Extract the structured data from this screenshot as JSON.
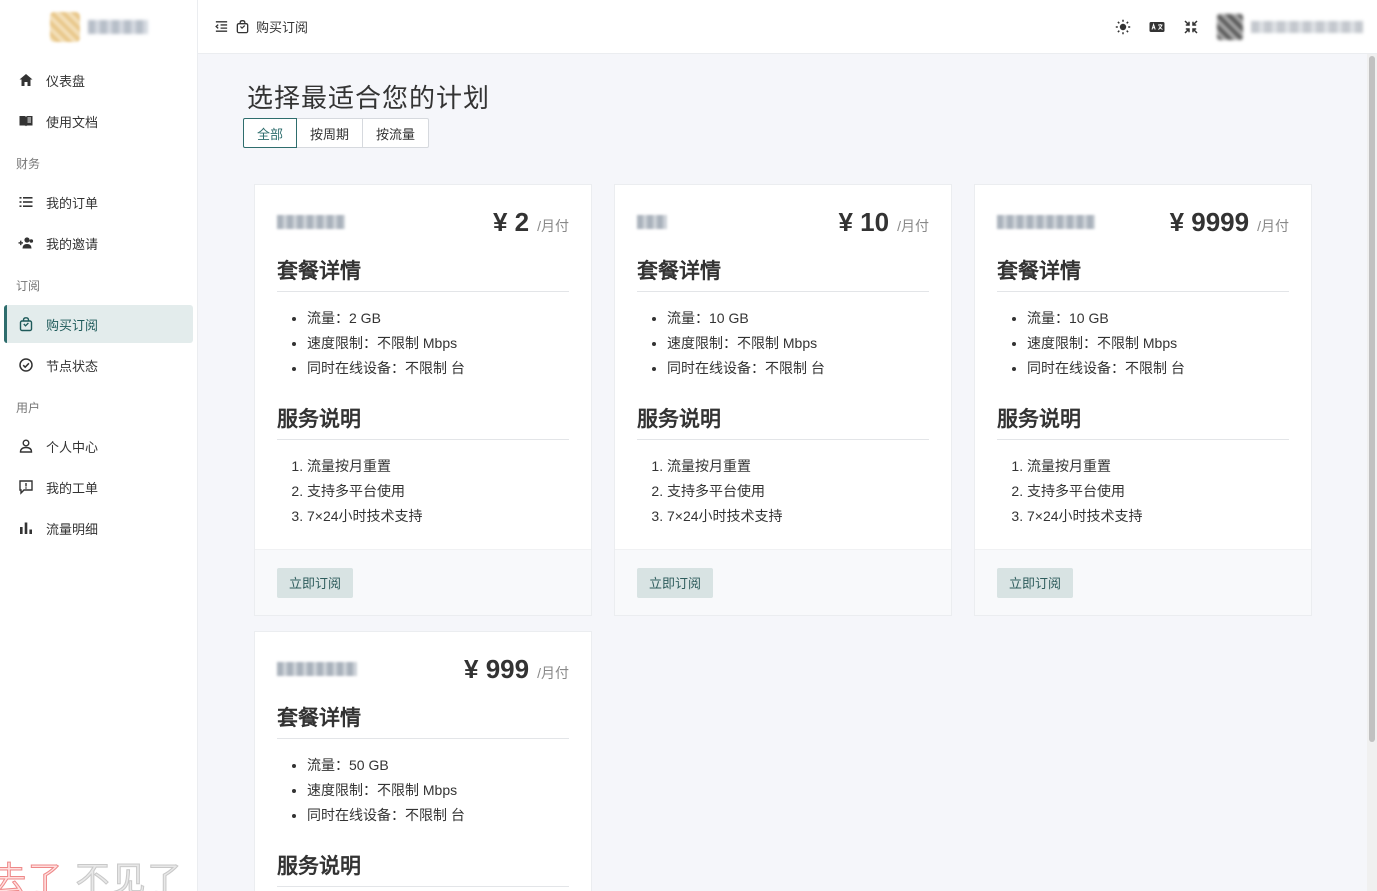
{
  "header": {
    "breadcrumb": "购买订阅"
  },
  "sidebar": {
    "items": [
      {
        "label": "仪表盘"
      },
      {
        "label": "使用文档"
      },
      {
        "group": "财务"
      },
      {
        "label": "我的订单"
      },
      {
        "label": "我的邀请"
      },
      {
        "group": "订阅"
      },
      {
        "label": "购买订阅"
      },
      {
        "label": "节点状态"
      },
      {
        "group": "用户"
      },
      {
        "label": "个人中心"
      },
      {
        "label": "我的工单"
      },
      {
        "label": "流量明细"
      }
    ]
  },
  "main": {
    "title": "选择最适合您的计划",
    "filters": [
      "全部",
      "按周期",
      "按流量"
    ],
    "plans": [
      {
        "price": "¥ 2",
        "period": "/月付",
        "details_title": "套餐详情",
        "features": [
          "流量：2 GB",
          "速度限制：不限制 Mbps",
          "同时在线设备：不限制 台"
        ],
        "service_title": "服务说明",
        "services": [
          "流量按月重置",
          "支持多平台使用",
          "7×24小时技术支持"
        ],
        "button": "立即订阅"
      },
      {
        "price": "¥ 10",
        "period": "/月付",
        "details_title": "套餐详情",
        "features": [
          "流量：10 GB",
          "速度限制：不限制 Mbps",
          "同时在线设备：不限制 台"
        ],
        "service_title": "服务说明",
        "services": [
          "流量按月重置",
          "支持多平台使用",
          "7×24小时技术支持"
        ],
        "button": "立即订阅"
      },
      {
        "price": "¥ 9999",
        "period": "/月付",
        "details_title": "套餐详情",
        "features": [
          "流量：10 GB",
          "速度限制：不限制 Mbps",
          "同时在线设备：不限制 台"
        ],
        "service_title": "服务说明",
        "services": [
          "流量按月重置",
          "支持多平台使用",
          "7×24小时技术支持"
        ],
        "button": "立即订阅"
      },
      {
        "price": "¥ 999",
        "period": "/月付",
        "details_title": "套餐详情",
        "features": [
          "流量：50 GB",
          "速度限制：不限制 Mbps",
          "同时在线设备：不限制 台"
        ],
        "service_title": "服务说明"
      }
    ]
  },
  "overlay": {
    "left": "去了",
    "right": "不见了"
  },
  "colors": {
    "accent": "#2e6d6d",
    "accent_bg": "#e3ecec",
    "button_bg": "#d8e3e3"
  }
}
